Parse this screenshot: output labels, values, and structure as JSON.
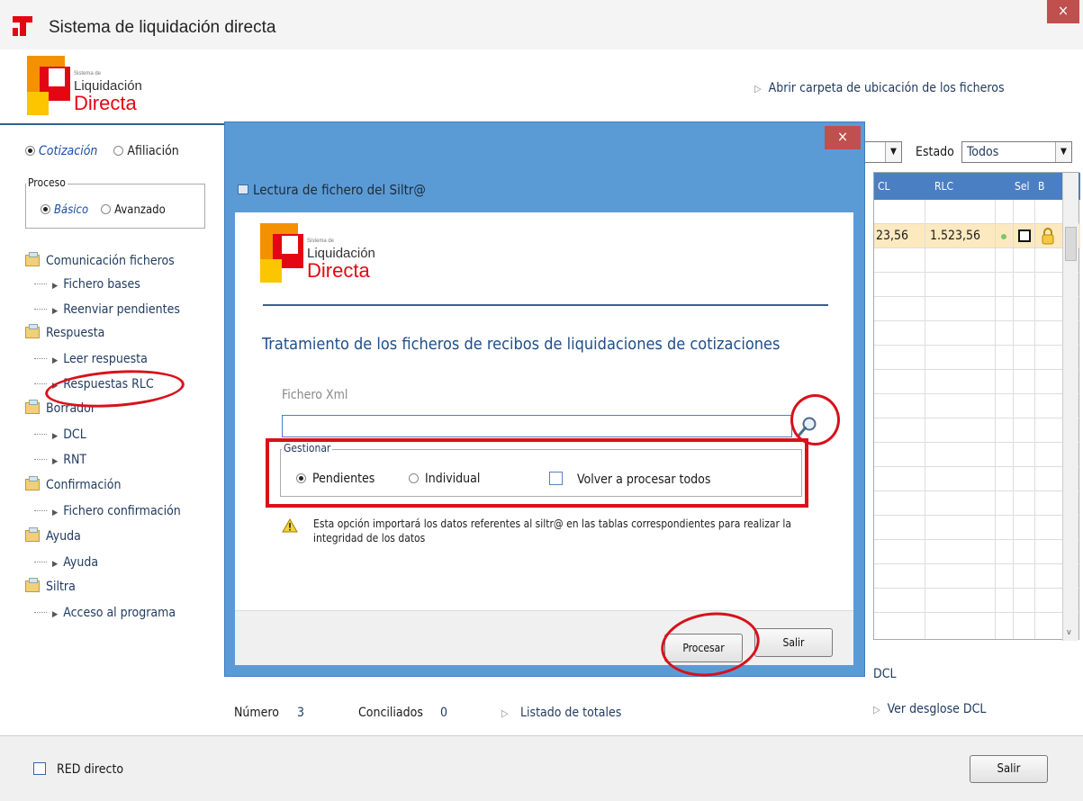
{
  "window": {
    "title": "Sistema de liquidación directa",
    "close_label": "×"
  },
  "logo": {
    "small": "Sistema de",
    "line1": "Liquidación",
    "line2": "Directa"
  },
  "header": {
    "open_folder_link": "Abrir carpeta de ubicación de los ficheros"
  },
  "sidebar": {
    "tabs": [
      {
        "label": "Cotización",
        "selected": true
      },
      {
        "label": "Afiliación",
        "selected": false
      }
    ],
    "proceso": {
      "legend": "Proceso",
      "options": [
        {
          "label": "Básico",
          "selected": true
        },
        {
          "label": "Avanzado",
          "selected": false
        }
      ]
    },
    "tree": [
      {
        "label": "Comunicación ficheros",
        "children": [
          "Fichero bases",
          "Reenviar pendientes"
        ]
      },
      {
        "label": "Respuesta",
        "children": [
          "Leer respuesta",
          "Respuestas RLC"
        ]
      },
      {
        "label": "Borrador",
        "children": [
          "DCL",
          "RNT"
        ]
      },
      {
        "label": "Confirmación",
        "children": [
          "Fichero confirmación"
        ]
      },
      {
        "label": "Ayuda",
        "children": [
          "Ayuda"
        ]
      },
      {
        "label": "Siltra",
        "children": [
          "Acceso al programa"
        ]
      }
    ]
  },
  "grid": {
    "estado_label": "Estado",
    "estado_value": "Todos",
    "columns": [
      "CL",
      "RLC",
      "Sel",
      "B"
    ],
    "rows": [
      {
        "dcl": "23,56",
        "rlc": "1.523,56"
      }
    ],
    "dcl_link": "DCL",
    "desglose_link": "Ver desglose DCL"
  },
  "status_bar": {
    "numero_label": "Número",
    "numero_value": "3",
    "conciliados_label": "Conciliados",
    "conciliados_value": "0",
    "listado_link": "Listado de totales"
  },
  "footer": {
    "red_directo_label": "RED directo",
    "salir_label": "Salir"
  },
  "modal": {
    "title": "Lectura de fichero del Siltr@",
    "close_label": "×",
    "subtitle": "Tratamiento de los ficheros de recibos de liquidaciones de cotizaciones",
    "fichero_label": "Fichero Xml",
    "fichero_value": "",
    "gestionar": {
      "legend": "Gestionar",
      "options": [
        {
          "label": "Pendientes",
          "selected": true
        },
        {
          "label": "Individual",
          "selected": false
        }
      ],
      "reprocess_label": "Volver a procesar todos",
      "reprocess_checked": false
    },
    "warning": "Esta opción importará los datos referentes al siltr@ en las tablas correspondientes para realizar la integridad de los datos",
    "buttons": {
      "procesar": "Procesar",
      "salir": "Salir"
    }
  },
  "colors": {
    "accent": "#4a7fc3",
    "modal_frame": "#5b9bd5",
    "annotation": "#d8111b",
    "brand_red": "#e30613"
  }
}
